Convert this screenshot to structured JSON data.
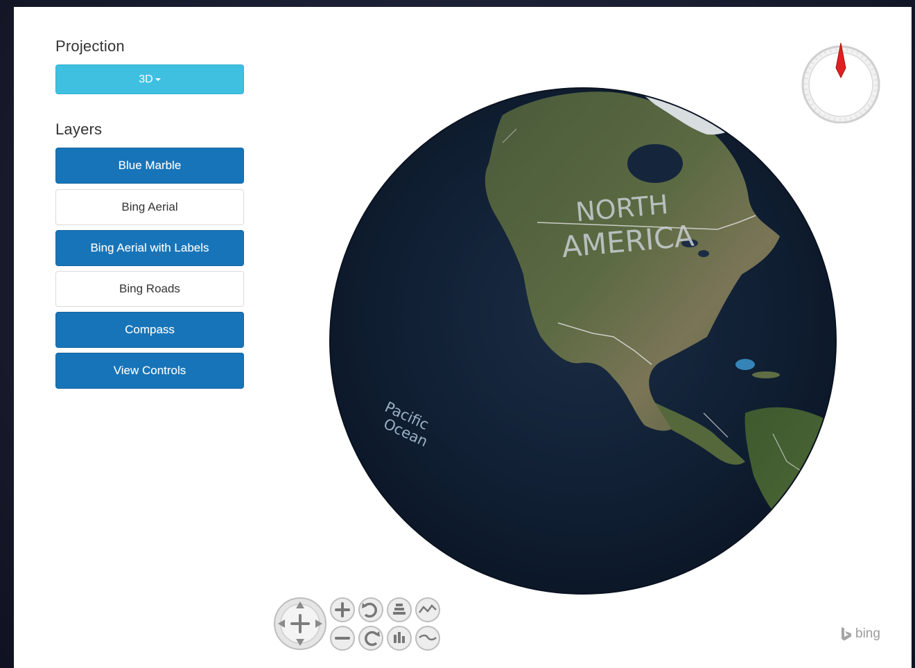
{
  "sidebar": {
    "projection_title": "Projection",
    "projection_value": "3D",
    "layers_title": "Layers",
    "layers": [
      {
        "label": "Blue Marble",
        "active": true
      },
      {
        "label": "Bing Aerial",
        "active": false
      },
      {
        "label": "Bing Aerial with Labels",
        "active": true
      },
      {
        "label": "Bing Roads",
        "active": false
      },
      {
        "label": "Compass",
        "active": true
      },
      {
        "label": "View Controls",
        "active": true
      }
    ]
  },
  "globe": {
    "continent_label_line1": "NORTH",
    "continent_label_line2": "AMERICA",
    "ocean_label_line1": "Pacific",
    "ocean_label_line2": "Ocean"
  },
  "compass": {
    "icon": "compass-icon",
    "needle_color": "#e02020"
  },
  "view_controls": {
    "pan_icon": "pan-icon",
    "buttons": [
      "zoom-in-icon",
      "rotate-ccw-icon",
      "tilt-up-icon",
      "elevation-up-icon",
      "zoom-out-icon",
      "rotate-cw-icon",
      "tilt-down-icon",
      "elevation-down-icon"
    ]
  },
  "attribution": {
    "logo_text": "bing"
  },
  "colors": {
    "active_button": "#1874b8",
    "projection_button": "#3fc0e0",
    "inactive_button": "#ffffff"
  }
}
